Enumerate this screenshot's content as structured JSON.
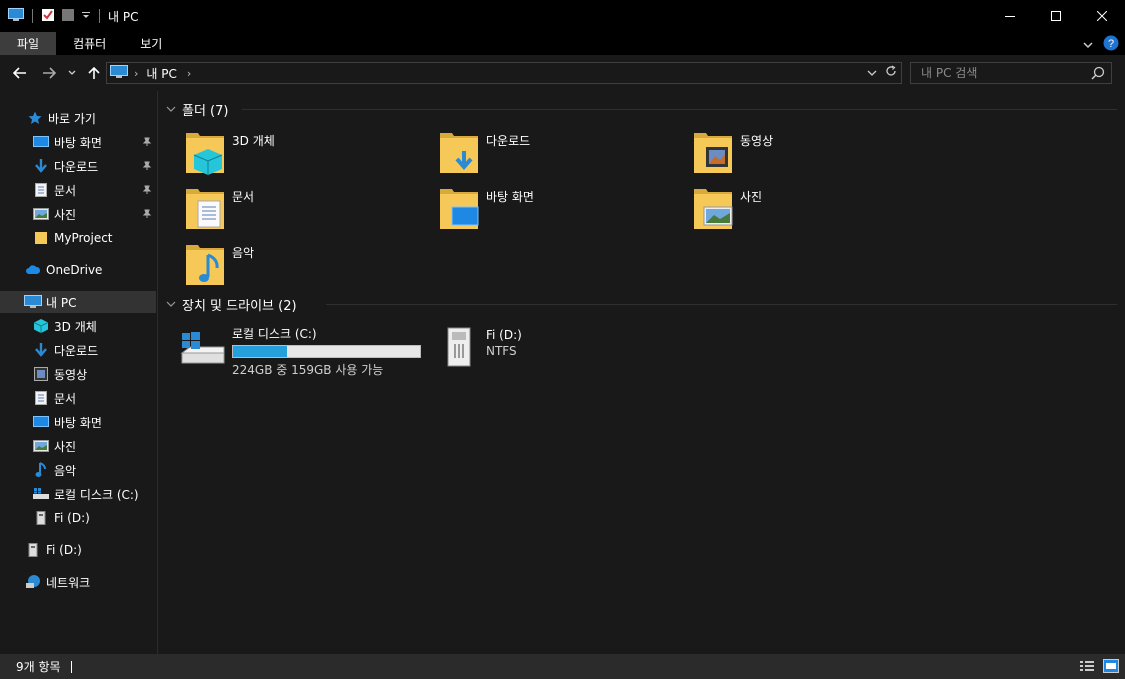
{
  "window": {
    "title": "내 PC"
  },
  "ribbon": {
    "tabs": [
      {
        "label": "파일",
        "active": true
      },
      {
        "label": "컴퓨터"
      },
      {
        "label": "보기"
      }
    ]
  },
  "address": {
    "crumb": "내 PC"
  },
  "search": {
    "placeholder": "내 PC 검색"
  },
  "sidebar": {
    "quick_access": "바로 가기",
    "quick_items": [
      "바탕 화면",
      "다운로드",
      "문서",
      "사진",
      "MyProject"
    ],
    "onedrive": "OneDrive",
    "thispc": "내 PC",
    "pc_items": [
      "3D 개체",
      "다운로드",
      "동영상",
      "문서",
      "바탕 화면",
      "사진",
      "음악",
      "로컬 디스크 (C:)",
      "Fi (D:)"
    ],
    "drive_d": "Fi (D:)",
    "network": "네트워크"
  },
  "content": {
    "folders_header": "폴더 (7)",
    "folders": [
      "3D 개체",
      "다운로드",
      "동영상",
      "문서",
      "바탕 화면",
      "사진",
      "음악"
    ],
    "devices_header": "장치 및 드라이브 (2)",
    "drive_c": {
      "name": "로컬 디스크 (C:)",
      "free_text": "224GB 중 159GB 사용 가능",
      "used_fraction": 0.29
    },
    "drive_d": {
      "name": "Fi (D:)",
      "fs": "NTFS"
    }
  },
  "status": {
    "count": "9개 항목"
  },
  "colors": {
    "accent": "#26a0da",
    "folder": "#f5c857",
    "bg": "#191919"
  }
}
